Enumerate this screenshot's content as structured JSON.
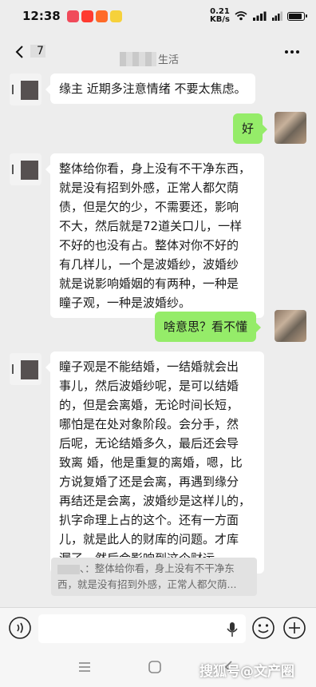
{
  "status_bar": {
    "time": "12:38",
    "net_speed": "0.21",
    "net_unit": "KB/s",
    "battery_level": 0.8,
    "app_icon_colors": [
      "#f04a5a",
      "#ff3b30",
      "#ff6a28",
      "#f6d13b"
    ]
  },
  "header": {
    "unread_count": "7",
    "title_suffix": "生活"
  },
  "messages": [
    {
      "side": "left",
      "lines": [
        "缘主 近期多注意情绪 不要太焦虑。"
      ]
    },
    {
      "side": "right",
      "lines": [
        "好"
      ]
    },
    {
      "side": "left",
      "lines": [
        "整体给你看，身上没有不干净东西，",
        "就是没有招到外感，正常人都欠荫",
        "债，但是欠的少，不需要还，影响",
        "不大，然后就是72道关口儿，一样",
        "不好的也没有占。整体对你不好的",
        "有几样儿，一个是波婚纱，波婚纱",
        "就是说影响婚姻的有两种，一种是",
        "瞳子观，一种是波婚纱。"
      ]
    },
    {
      "side": "right",
      "lines": [
        "啥意思？看不懂"
      ]
    },
    {
      "side": "left",
      "lines": [
        "瞳子观是不能结婚，一结婚就会出",
        "事儿，然后波婚纱呢，是可以结婚",
        "的，但是会离婚，无论时间长短，",
        "哪怕是在处对象阶段。会分手，然",
        "后呢，无论结婚多久，最后还会导",
        "致离 婚，他是重复的离婚，嗯，比",
        "方说复婚了还是会离，再遇到缘分",
        "再结还是会离，波婚纱是这样儿的，",
        "扒字命理上占的这个。还有一方面",
        "儿，就是此人的财库的问题。才库",
        "漏了，然后会影响到这个财运。"
      ]
    }
  ],
  "quoted_reply": {
    "lines": [
      "、：整体给你看，身上没有不干净东",
      "西，就是没有招到外感，正常人都欠荫..."
    ]
  },
  "watermark": "搜狐号@文产圈",
  "colors": {
    "background": "#ededed",
    "incoming_bubble": "#ffffff",
    "outgoing_bubble": "#95ec69"
  }
}
